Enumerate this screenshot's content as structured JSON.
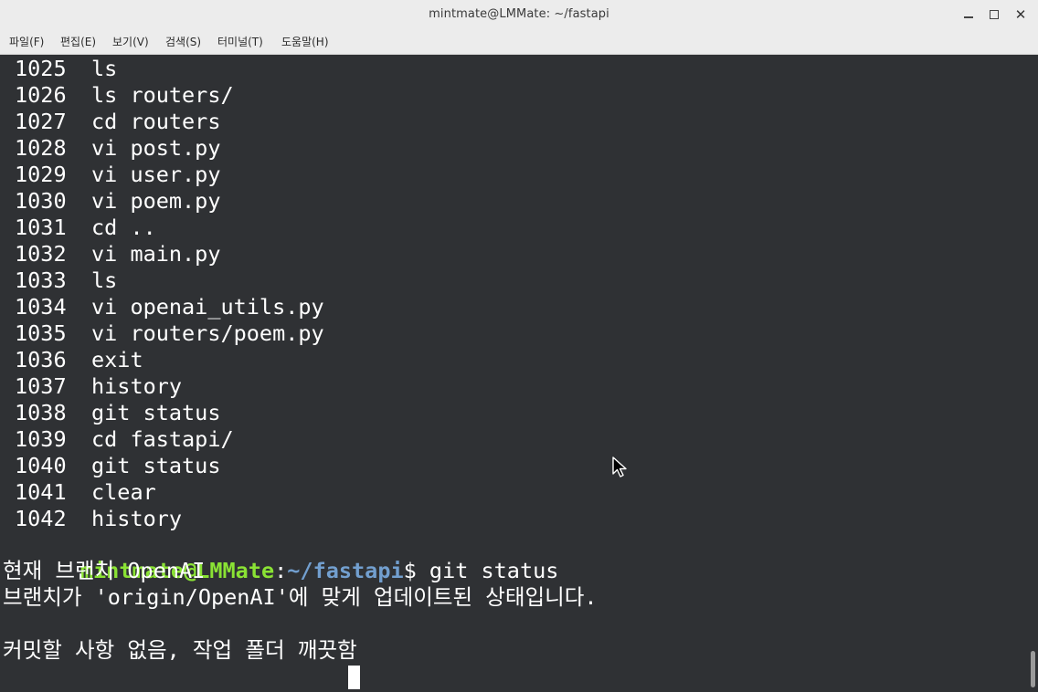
{
  "window": {
    "title": "mintmate@LMMate: ~/fastapi",
    "minimize_icon": "minimize-icon",
    "maximize_icon": "maximize-icon",
    "close_icon": "close-icon",
    "close_glyph": "✕"
  },
  "menubar": {
    "items": [
      "파일(F)",
      "편집(E)",
      "보기(V)",
      "검색(S)",
      "터미널(T)",
      "도움말(H)"
    ]
  },
  "terminal": {
    "history": [
      {
        "num": "1025",
        "cmd": "ls"
      },
      {
        "num": "1026",
        "cmd": "ls routers/"
      },
      {
        "num": "1027",
        "cmd": "cd routers"
      },
      {
        "num": "1028",
        "cmd": "vi post.py"
      },
      {
        "num": "1029",
        "cmd": "vi user.py"
      },
      {
        "num": "1030",
        "cmd": "vi poem.py"
      },
      {
        "num": "1031",
        "cmd": "cd .."
      },
      {
        "num": "1032",
        "cmd": "vi main.py"
      },
      {
        "num": "1033",
        "cmd": "ls"
      },
      {
        "num": "1034",
        "cmd": "vi openai_utils.py"
      },
      {
        "num": "1035",
        "cmd": "vi routers/poem.py"
      },
      {
        "num": "1036",
        "cmd": "exit"
      },
      {
        "num": "1037",
        "cmd": "history"
      },
      {
        "num": "1038",
        "cmd": "git status"
      },
      {
        "num": "1039",
        "cmd": "cd fastapi/"
      },
      {
        "num": "1040",
        "cmd": "git status"
      },
      {
        "num": "1041",
        "cmd": "clear"
      },
      {
        "num": "1042",
        "cmd": "history"
      }
    ],
    "prompt_user": "mintmate@LMMate",
    "prompt_sep": ":",
    "prompt_path": "~/fastapi",
    "prompt_symbol": "$ ",
    "command": "git status",
    "output": [
      "현재 브랜치 OpenAI",
      "브랜치가 'origin/OpenAI'에 맞게 업데이트된 상태입니다.",
      "",
      "커밋할 사항 없음, 작업 폴더 깨끗함"
    ]
  },
  "colors": {
    "background": "#2f3134",
    "prompt_user": "#8ae234",
    "prompt_path": "#729fcf",
    "text": "#ffffff"
  }
}
